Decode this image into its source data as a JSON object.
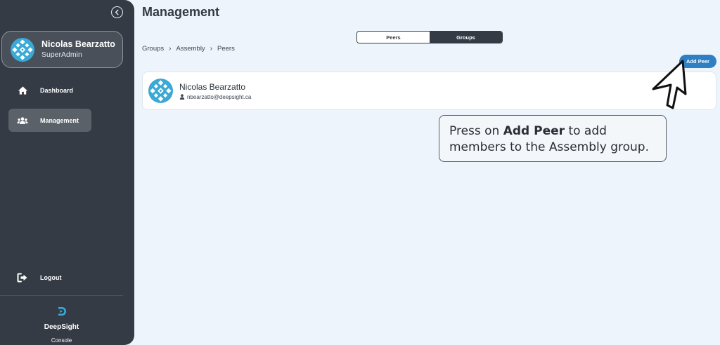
{
  "sidebar": {
    "user": {
      "name": "Nicolas Bearzatto",
      "role": "SuperAdmin"
    },
    "nav": {
      "dashboard": "Dashboard",
      "management": "Management",
      "logout": "Logout"
    },
    "brand": {
      "name": "DeepSight",
      "sub": "Console"
    }
  },
  "main": {
    "title": "Management",
    "breadcrumb": [
      "Groups",
      "Assembly",
      "Peers"
    ],
    "toggle": {
      "peers": "Peers",
      "groups": "Groups",
      "active": "Groups"
    },
    "add_peer_label": "Add Peer",
    "peers": [
      {
        "name": "Nicolas Bearzatto",
        "email": "nbearzatto@deepsight.ca"
      }
    ]
  },
  "callout": {
    "prefix": "Press on ",
    "highlight": "Add Peer",
    "suffix_line1": " to add",
    "line2": "members to the Assembly group."
  },
  "icons": {
    "collapse": "chevron-left-circle-icon",
    "dashboard": "home-icon",
    "management": "users-icon",
    "logout": "logout-icon",
    "brand": "deepsight-logo-icon",
    "email": "person-icon",
    "cursor": "mouse-pointer-icon"
  },
  "colors": {
    "sidebar": "#353b44",
    "active_nav": "#5b6169",
    "accent": "#2f7fc4",
    "avatar": "#3aa9d6",
    "background": "#eef4fb"
  }
}
